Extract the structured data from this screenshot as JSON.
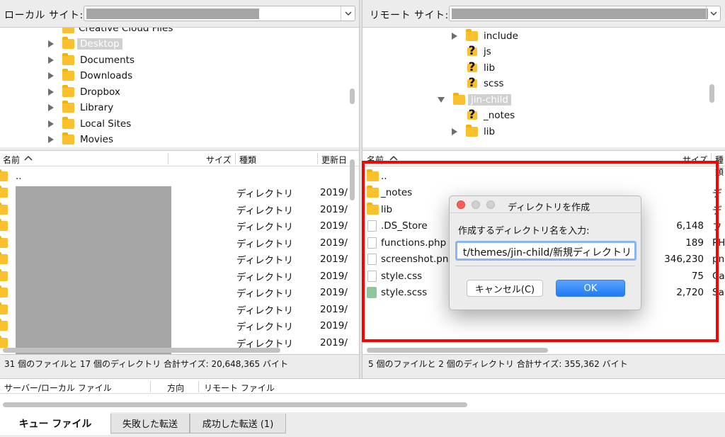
{
  "local": {
    "site_label": "ローカル サイト:",
    "tree": [
      {
        "label": "Creative Cloud Files",
        "cut": true
      },
      {
        "label": "Desktop",
        "selected": true
      },
      {
        "label": "Documents"
      },
      {
        "label": "Downloads"
      },
      {
        "label": "Dropbox"
      },
      {
        "label": "Library"
      },
      {
        "label": "Local Sites"
      },
      {
        "label": "Movies"
      }
    ],
    "columns": {
      "name": "名前",
      "size": "サイズ",
      "type": "種類",
      "modified": "更新日"
    },
    "rows": [
      {
        "name": "..",
        "type": "",
        "date": ""
      },
      {
        "type": "ディレクトリ",
        "date": "2019/"
      },
      {
        "type": "ディレクトリ",
        "date": "2019/"
      },
      {
        "type": "ディレクトリ",
        "date": "2019/"
      },
      {
        "type": "ディレクトリ",
        "date": "2019/"
      },
      {
        "type": "ディレクトリ",
        "date": "2019/"
      },
      {
        "type": "ディレクトリ",
        "date": "2019/"
      },
      {
        "type": "ディレクトリ",
        "date": "2019/"
      },
      {
        "type": "ディレクトリ",
        "date": "2019/"
      },
      {
        "type": "ディレクトリ",
        "date": "2019/"
      },
      {
        "type": "ディレクトリ",
        "date": "2019/"
      }
    ],
    "status": "31 個のファイルと 17 個のディレクトリ 合計サイズ: 20,648,365 バイト"
  },
  "remote": {
    "site_label": "リモート サイト:",
    "tree": [
      {
        "label": "include",
        "icon": "folder",
        "expander": "right"
      },
      {
        "label": "js",
        "icon": "unknown"
      },
      {
        "label": "lib",
        "icon": "unknown"
      },
      {
        "label": "scss",
        "icon": "unknown"
      },
      {
        "label": "jin-child",
        "icon": "folder",
        "expander": "down",
        "selected": true
      },
      {
        "label": "_notes",
        "icon": "unknown"
      },
      {
        "label": "lib",
        "icon": "folder",
        "expander": "right"
      }
    ],
    "columns": {
      "name": "名前",
      "size": "サイズ",
      "type": "種類"
    },
    "rows": [
      {
        "name": "..",
        "icon": "folder",
        "size": "",
        "type": ""
      },
      {
        "name": "_notes",
        "icon": "folder",
        "size": "",
        "type": "デ"
      },
      {
        "name": "lib",
        "icon": "folder",
        "size": "",
        "type": "デ"
      },
      {
        "name": ".DS_Store",
        "icon": "file",
        "size": "6,148",
        "type": "フ"
      },
      {
        "name": "functions.php",
        "icon": "file",
        "size": "189",
        "type": "PH"
      },
      {
        "name": "screenshot.png",
        "icon": "file",
        "size": "346,230",
        "type": "pn"
      },
      {
        "name": "style.css",
        "icon": "file",
        "size": "75",
        "type": "Ca"
      },
      {
        "name": "style.scss",
        "icon": "scss",
        "size": "2,720",
        "type": "Sa"
      }
    ],
    "status": "5 個のファイルと 2 個のディレクトリ 合計サイズ: 355,362 バイト"
  },
  "dialog": {
    "title": "ディレクトリを作成",
    "prompt": "作成するディレクトリ名を入力:",
    "value": "t/themes/jin-child/新規ディレクトリ",
    "cancel": "キャンセル(C)",
    "ok": "OK"
  },
  "queue": {
    "col_server": "サーバー/ローカル ファイル",
    "col_direction": "方向",
    "col_remote": "リモート ファイル",
    "tabs": [
      "キュー ファイル",
      "失敗した転送",
      "成功した転送 (1)"
    ]
  },
  "colors": {
    "highlight": "#ff0000",
    "folder": "#fbc02d",
    "ok_button": "#1f7cf5"
  }
}
